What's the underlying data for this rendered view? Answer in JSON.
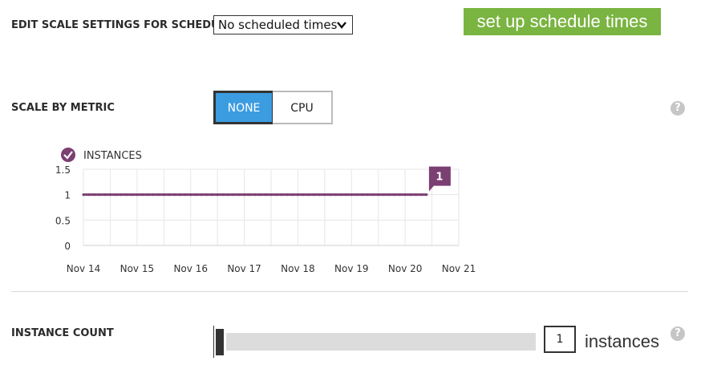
{
  "schedule": {
    "label": "EDIT SCALE SETTINGS FOR SCHEDULE",
    "selected": "No scheduled times",
    "setup_button": "set up schedule times"
  },
  "metric": {
    "label": "SCALE BY METRIC",
    "options": [
      "NONE",
      "CPU"
    ],
    "selected": "NONE",
    "help": "?"
  },
  "chart_data": {
    "type": "line",
    "legend": "INSTANCES",
    "x_labels": [
      "Nov 14",
      "Nov 15",
      "Nov 16",
      "Nov 17",
      "Nov 18",
      "Nov 19",
      "Nov 20",
      "Nov 21"
    ],
    "y_ticks": [
      "1.5",
      "1",
      "0.5",
      "0"
    ],
    "ylim": [
      0,
      1.5
    ],
    "series": [
      {
        "name": "INSTANCES",
        "x_start": 0,
        "x_end": 6.4,
        "value": 1
      }
    ],
    "current_value_label": "1",
    "color": "#7b3f72"
  },
  "instances": {
    "label": "INSTANCE COUNT",
    "count": "1",
    "unit": "instances",
    "help": "?"
  }
}
